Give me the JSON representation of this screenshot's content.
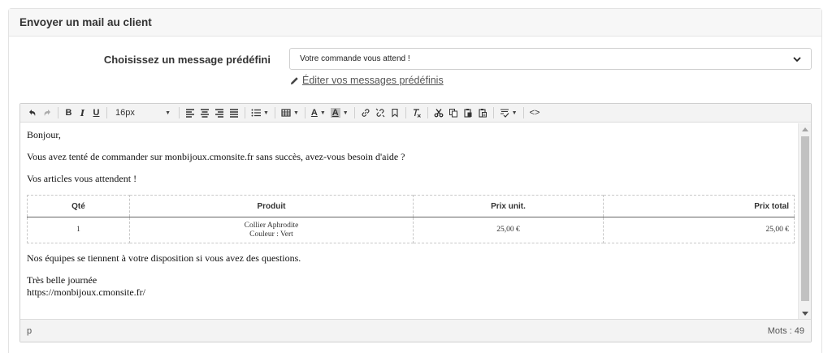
{
  "panel": {
    "title": "Envoyer un mail au client"
  },
  "form": {
    "label": "Choisissez un message prédéfini",
    "select_value": "Votre commande vous attend !",
    "edit_link": "Éditer vos messages prédéfinis"
  },
  "toolbar": {
    "font_size": "16px",
    "bold": "B",
    "italic": "I",
    "underline": "U",
    "font_color": "A",
    "bg_color": "A",
    "code": "<>"
  },
  "content": {
    "greeting": "Bonjour,",
    "line1": "Vous avez tenté de commander sur monbijoux.cmonsite.fr sans succès, avez-vous besoin d'aide ?",
    "line2": "Vos articles vous attendent !",
    "table": {
      "headers": [
        "Qté",
        "Produit",
        "Prix unit.",
        "Prix total"
      ],
      "row": {
        "qty": "1",
        "product": "Collier Aphrodite",
        "variant": "Couleur : Vert",
        "unit_price": "25,00 €",
        "total_price": "25,00 €"
      }
    },
    "line3": "Nos équipes se tiennent à votre disposition si vous avez des questions.",
    "signoff": "Très belle journée",
    "url": "https://monbijoux.cmonsite.fr/"
  },
  "status": {
    "element": "p",
    "words": "Mots : 49"
  }
}
